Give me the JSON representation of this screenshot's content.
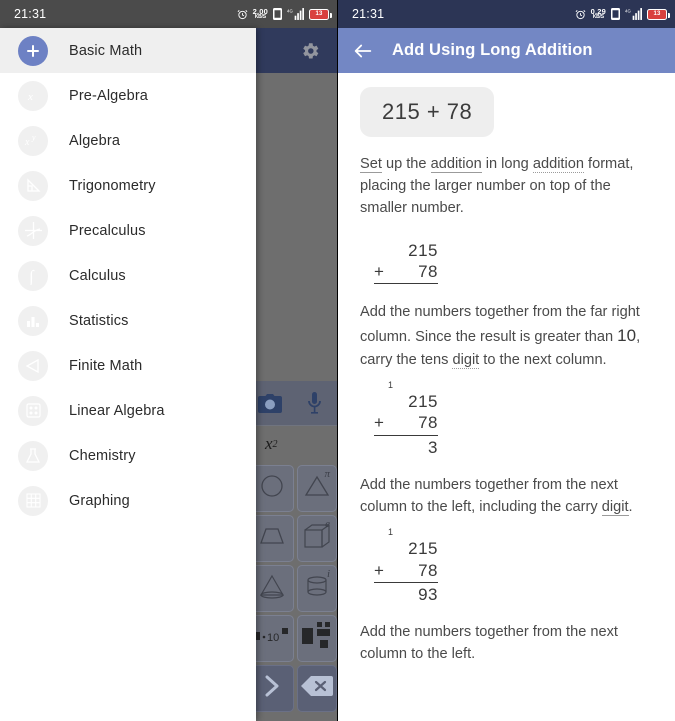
{
  "left_screen": {
    "status_bar": {
      "time": "21:31",
      "icons": [
        "alarm-icon",
        "network-speed",
        "sim-icon",
        "signal-icon",
        "battery-icon"
      ],
      "net_speed_value": "2.00",
      "net_speed_unit": "KB/S",
      "battery_level": "13"
    },
    "app_bar": {
      "settings_label": "gear-icon"
    },
    "drawer": {
      "items": [
        {
          "label": "Basic Math",
          "icon": "plus-icon",
          "selected": true
        },
        {
          "label": "Pre-Algebra",
          "icon": "variable-x-icon",
          "selected": false
        },
        {
          "label": "Algebra",
          "icon": "x-power-y-icon",
          "selected": false
        },
        {
          "label": "Trigonometry",
          "icon": "set-square-icon",
          "selected": false
        },
        {
          "label": "Precalculus",
          "icon": "axes-icon",
          "selected": false
        },
        {
          "label": "Calculus",
          "icon": "integral-icon",
          "selected": false
        },
        {
          "label": "Statistics",
          "icon": "bar-chart-icon",
          "selected": false
        },
        {
          "label": "Finite Math",
          "icon": "share-node-icon",
          "selected": false
        },
        {
          "label": "Linear Algebra",
          "icon": "matrix-icon",
          "selected": false
        },
        {
          "label": "Chemistry",
          "icon": "flask-icon",
          "selected": false
        },
        {
          "label": "Graphing",
          "icon": "grid-icon",
          "selected": false
        }
      ]
    },
    "keyboard": {
      "action_row": [
        "camera-icon",
        "microphone-icon"
      ],
      "x_squared": "x",
      "x_squared_exp": "2",
      "keys": [
        {
          "icon": "circle-icon",
          "sup": ""
        },
        {
          "icon": "triangle-icon",
          "sup": "π"
        },
        {
          "icon": "trapezoid-icon",
          "sup": ""
        },
        {
          "icon": "cube-icon",
          "sup": "e"
        },
        {
          "icon": "cone-icon",
          "sup": ""
        },
        {
          "icon": "cylinder-icon",
          "sup": "i"
        },
        {
          "icon": "sci-notation-icon",
          "sup": ""
        },
        {
          "icon": "fraction-icon",
          "sup": ""
        }
      ],
      "enter_label": "enter-icon",
      "delete_label": "backspace-icon"
    }
  },
  "right_screen": {
    "status_bar": {
      "time": "21:31",
      "net_speed_value": "0.29",
      "net_speed_unit": "KB/S",
      "battery_level": "13"
    },
    "app_bar": {
      "back_icon": "back-arrow-icon",
      "title": "Add Using Long Addition"
    },
    "problem_chip": "215 + 78",
    "steps": [
      {
        "text_runs": [
          {
            "t": "Set",
            "deco": "solid"
          },
          {
            "t": " up the ",
            "deco": "none"
          },
          {
            "t": "addition",
            "deco": "solid"
          },
          {
            "t": " in long ",
            "deco": "none"
          },
          {
            "t": "addition",
            "deco": "dotted"
          },
          {
            "t": " format, placing the larger number on top of the smaller number.",
            "deco": "none"
          }
        ],
        "sum": {
          "carry": "",
          "top": "215",
          "op": "+",
          "bottom": "78",
          "result": ""
        }
      },
      {
        "text_runs": [
          {
            "t": "Add the numbers together from the far right column. Since the result is greater than ",
            "deco": "none"
          },
          {
            "t": "10",
            "deco": "big"
          },
          {
            "t": ", carry the tens ",
            "deco": "none"
          },
          {
            "t": "digit",
            "deco": "dotted"
          },
          {
            "t": " to the next column.",
            "deco": "none"
          }
        ],
        "sum": {
          "carry": "1",
          "top": "215",
          "op": "+",
          "bottom": "78",
          "result": "3"
        }
      },
      {
        "text_runs": [
          {
            "t": "Add the numbers together from the next column to the left, including the carry ",
            "deco": "none"
          },
          {
            "t": "digit",
            "deco": "solid"
          },
          {
            "t": ".",
            "deco": "none"
          }
        ],
        "sum": {
          "carry": "1",
          "top": "215",
          "op": "+",
          "bottom": "78",
          "result": "93"
        }
      },
      {
        "text_runs": [
          {
            "t": "Add the numbers together from the next column to the left.",
            "deco": "none"
          }
        ],
        "sum": null
      }
    ]
  }
}
